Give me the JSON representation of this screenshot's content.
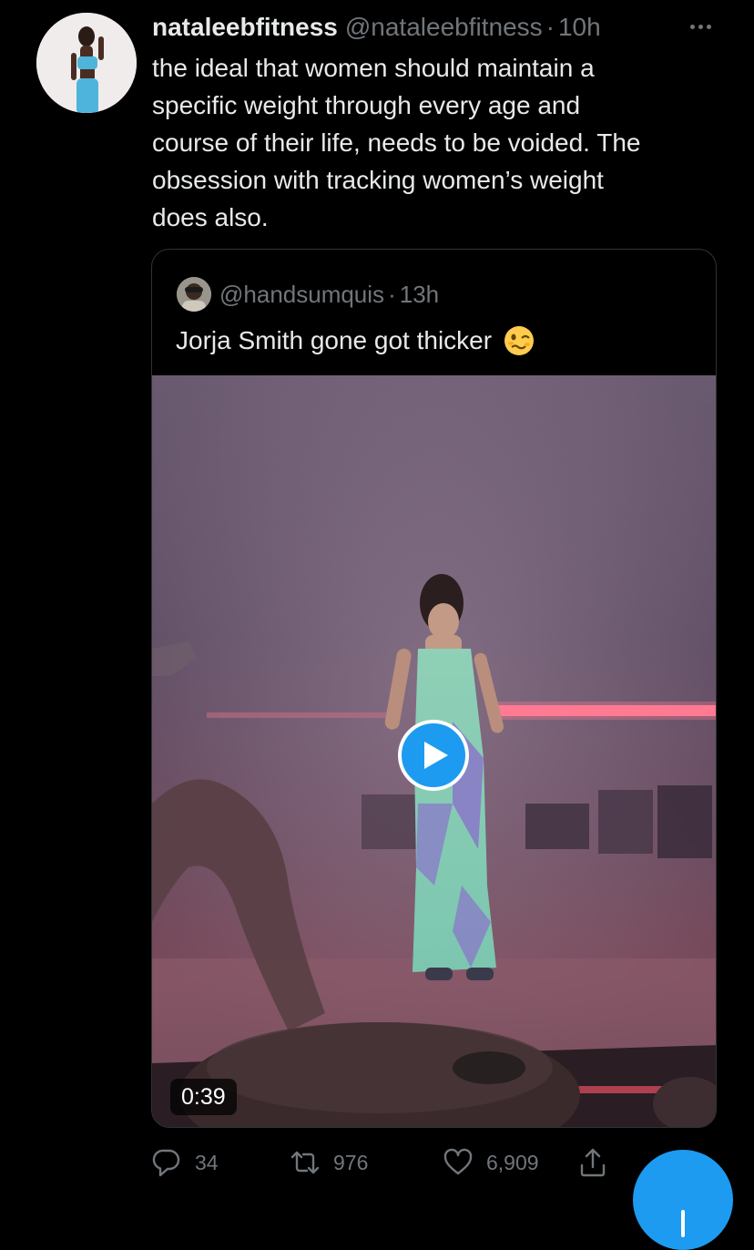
{
  "tweet": {
    "display_name": "nataleebfitness",
    "handle": "@nataleebfitness",
    "separator": "·",
    "time": "10h",
    "text_lines": [
      "the ideal that women should maintain a",
      "specific weight through every age and",
      "course of their life, needs to be voided. The",
      "obsession with tracking women’s weight",
      "does also."
    ]
  },
  "quoted": {
    "handle": "@handsumquis",
    "separator": "·",
    "time": "13h",
    "text": "Jorja Smith gone got thicker",
    "emoji": "woozy-face",
    "video_duration": "0:39"
  },
  "actions": {
    "replies": "34",
    "retweets": "976",
    "likes": "6,909"
  },
  "icons": [
    "more-icon",
    "reply-icon",
    "retweet-icon",
    "like-icon",
    "share-icon",
    "play-icon",
    "compose-icon"
  ],
  "colors": {
    "background": "#000000",
    "text": "#e7e9ea",
    "muted": "#71767b",
    "accent": "#1d9bf0",
    "border": "#2f3336"
  }
}
